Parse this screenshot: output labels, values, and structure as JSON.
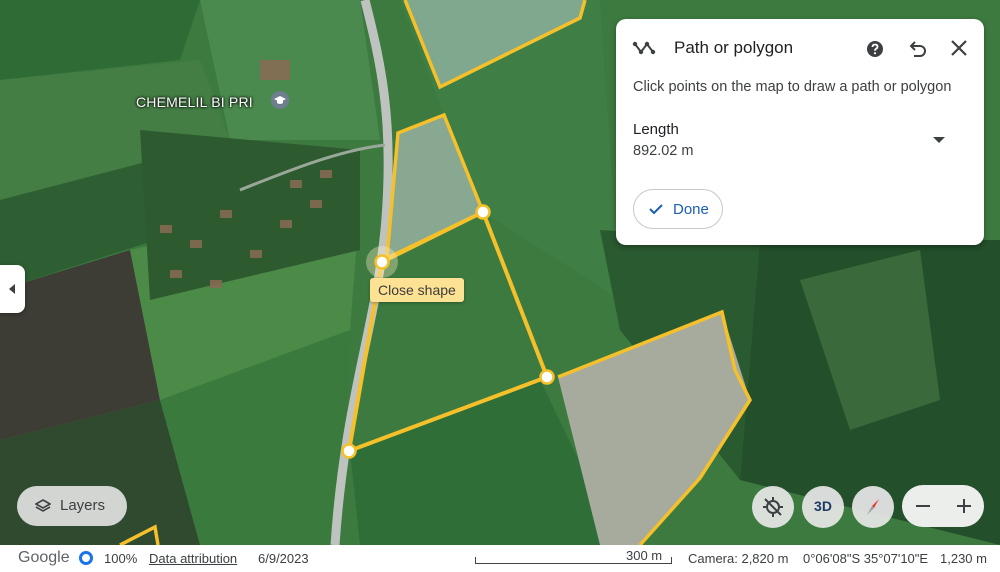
{
  "map": {
    "place_label": "CHEMELIL BI PRI",
    "place_icon": "school-icon",
    "tooltip": "Close shape"
  },
  "panel": {
    "icon": "path-icon",
    "title": "Path or polygon",
    "instructions": "Click points on the map to draw a path or polygon",
    "length_label": "Length",
    "length_value": "892.02 m",
    "done_label": "Done",
    "help_icon": "help-icon",
    "undo_icon": "undo-icon",
    "close_icon": "close-icon"
  },
  "controls": {
    "layers_label": "Layers",
    "btn_3d": "3D"
  },
  "status": {
    "brand": "Google",
    "zoom": "100%",
    "data_attribution": "Data attribution",
    "date": "6/9/2023",
    "scale": "300 m",
    "camera": "Camera: 2,820 m",
    "coordinates": "0°06'08\"S 35°07'10\"E",
    "elevation": "1,230 m"
  },
  "colors": {
    "shape_outline": "#f5c02a",
    "accent": "#1a73e8"
  }
}
